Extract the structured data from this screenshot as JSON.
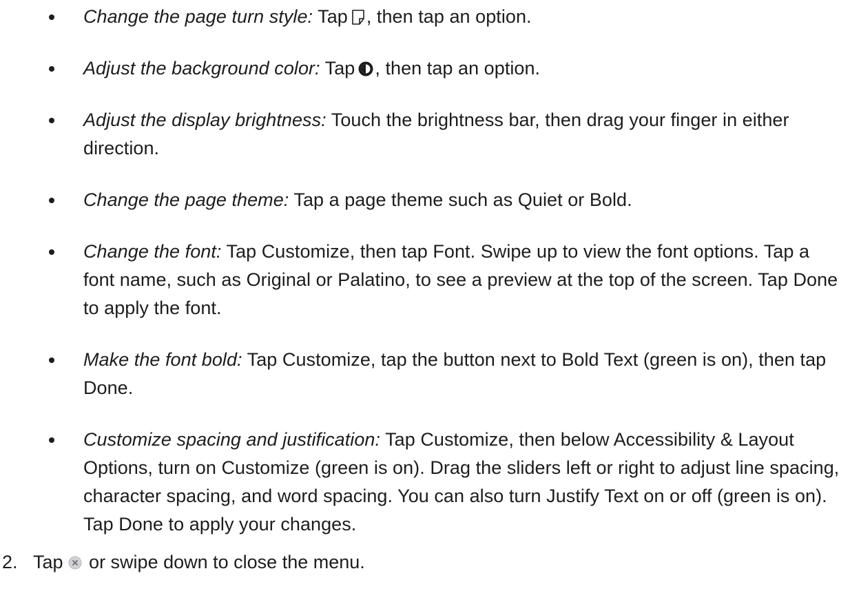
{
  "bullets": [
    {
      "lead": "Change the page turn style:",
      "before_icon": " Tap",
      "icon": "page-turn-icon",
      "after_icon": ", then tap an option."
    },
    {
      "lead": "Adjust the background color:",
      "before_icon": " Tap",
      "icon": "background-color-icon",
      "after_icon": ", then tap an option."
    },
    {
      "lead": "Adjust the display brightness:",
      "text": " Touch the brightness bar, then drag your finger in either direction."
    },
    {
      "lead": "Change the page theme:",
      "text": " Tap a page theme such as Quiet or Bold."
    },
    {
      "lead": "Change the font:",
      "text": " Tap Customize, then tap Font. Swipe up to view the font options. Tap a font name, such as Original or Palatino, to see a preview at the top of the screen. Tap Done to apply the font."
    },
    {
      "lead": "Make the font bold:",
      "text": " Tap Customize, tap the button next to Bold Text (green is on), then tap Done."
    },
    {
      "lead": "Customize spacing and justification:",
      "text": " Tap Customize, then below Accessibility & Layout Options, turn on Customize (green is on). Drag the sliders left or right to adjust line spacing, character spacing, and word spacing. You can also turn Justify Text on or off (green is on). Tap Done to apply your changes."
    }
  ],
  "step2": {
    "number": "2.",
    "before_icon": "Tap",
    "icon": "close-circle-icon",
    "after_icon": " or swipe down to close the menu."
  }
}
